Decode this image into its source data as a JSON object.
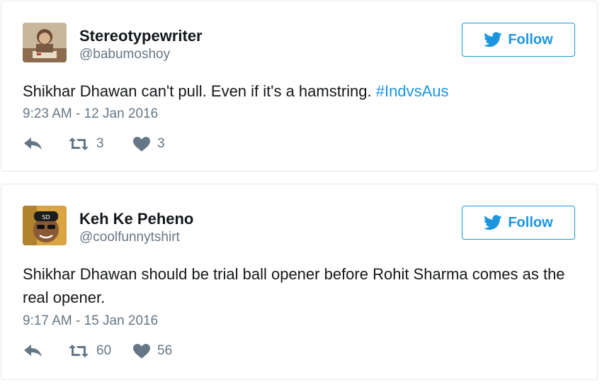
{
  "tweets": [
    {
      "display_name": "Stereotypewriter",
      "handle": "@babumoshoy",
      "text": "Shikhar Dhawan can't pull. Even if it's a hamstring. ",
      "hashtag": "#IndvsAus",
      "timestamp": "9:23 AM - 12 Jan 2016",
      "retweets": "3",
      "likes": "3",
      "follow_label": "Follow"
    },
    {
      "display_name": "Keh Ke Peheno",
      "handle": "@coolfunnytshirt",
      "text": "Shikhar Dhawan should be trial ball opener before Rohit Sharma comes as the real opener.",
      "timestamp": "9:17 AM - 15 Jan 2016",
      "retweets": "60",
      "likes": "56",
      "follow_label": "Follow"
    }
  ],
  "icons": {
    "follow": "twitter-bird-icon",
    "reply": "reply-icon",
    "retweet": "retweet-icon",
    "like": "heart-icon"
  },
  "colors": {
    "brand_blue": "#1b95e0",
    "muted_gray": "#657786",
    "text_dark": "#14171a",
    "card_border": "#e1e8ed"
  }
}
